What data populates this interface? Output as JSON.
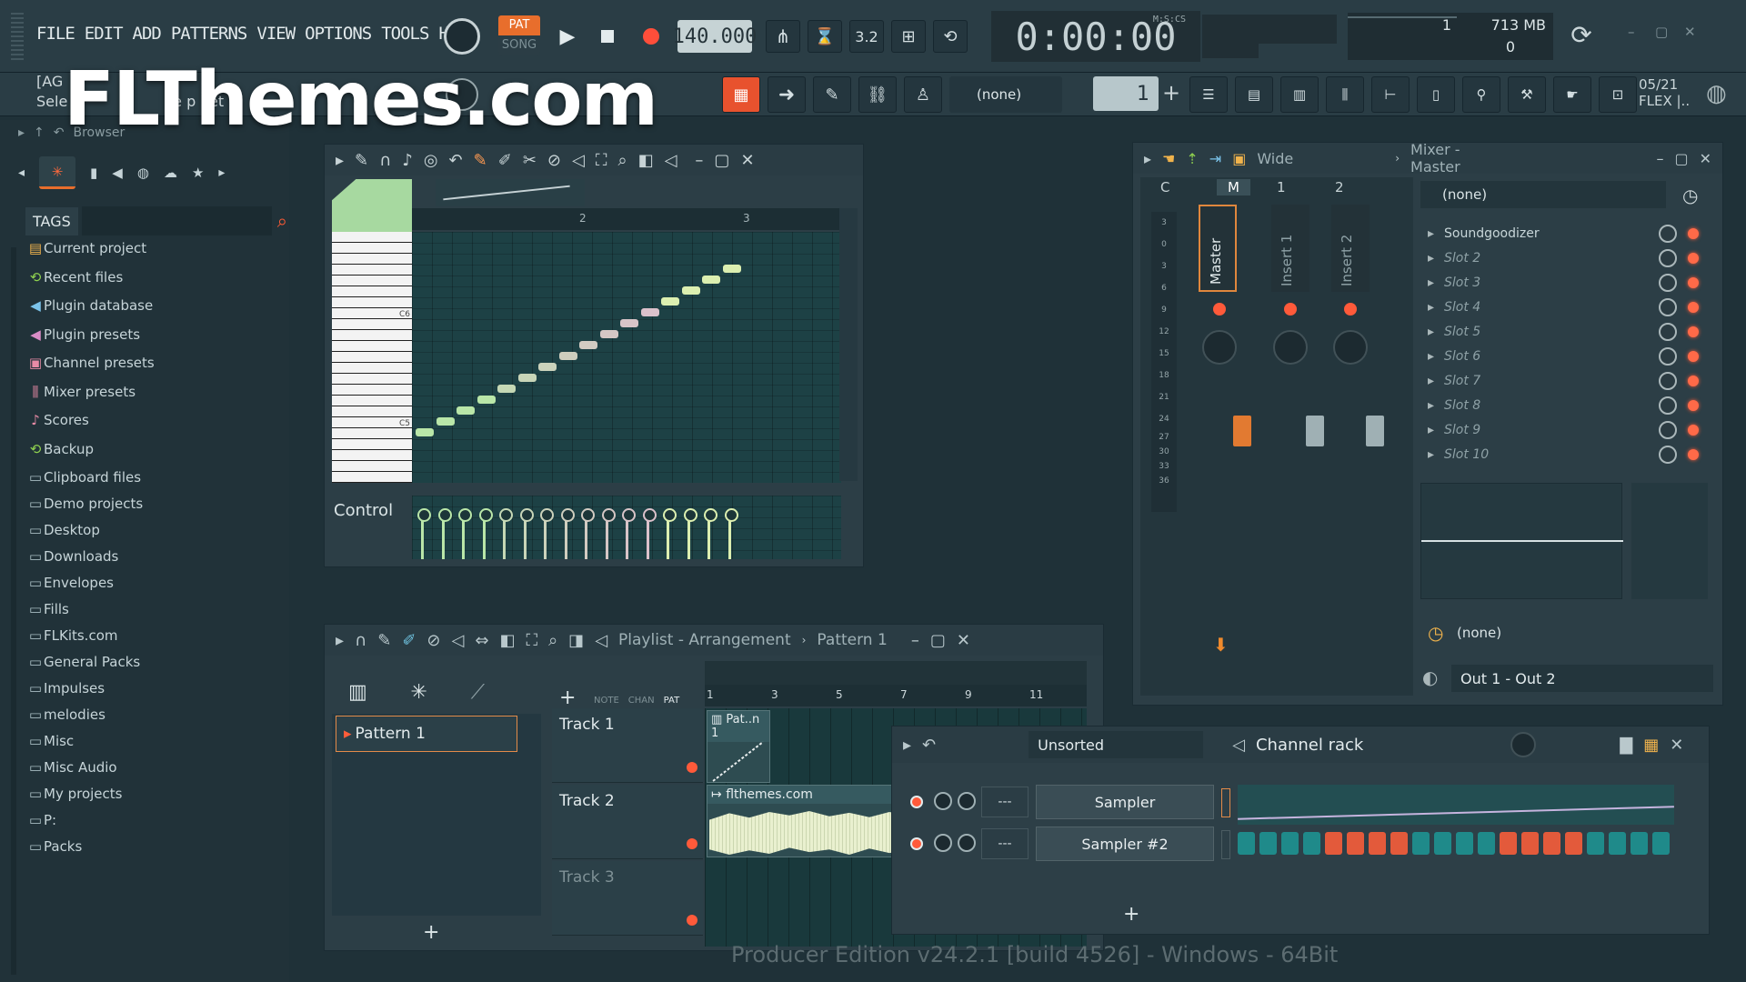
{
  "menu": [
    "FILE",
    "EDIT",
    "ADD",
    "PATTERNS",
    "VIEW",
    "OPTIONS",
    "TOOLS",
    "HELP"
  ],
  "transport": {
    "pat": "PAT",
    "song": "SONG",
    "tempo": "140.000",
    "time": "0:00:00",
    "time_unit": "M:S:CS",
    "metronome": "3.2"
  },
  "cpu": {
    "voices": "1",
    "memory": "713 MB",
    "polyphony": "0"
  },
  "hint": {
    "line1": "[AG",
    "line2": "Sele",
    "line2b": "he p",
    "line2c": "et"
  },
  "toolbar2": {
    "pattern_selector": "(none)",
    "pattern_number": "1",
    "news": "05/21",
    "news_line2": "FLEX |.."
  },
  "watermark": "FLThemes.com",
  "browser": {
    "title": "Browser",
    "tags_label": "TAGS",
    "items": [
      {
        "label": "Current project",
        "icon": "project-icon"
      },
      {
        "label": "Recent files",
        "icon": "folder-refresh-icon"
      },
      {
        "label": "Plugin database",
        "icon": "plugin-icon"
      },
      {
        "label": "Plugin presets",
        "icon": "plugin-preset-icon"
      },
      {
        "label": "Channel presets",
        "icon": "channel-icon"
      },
      {
        "label": "Mixer presets",
        "icon": "mixer-icon"
      },
      {
        "label": "Scores",
        "icon": "note-icon"
      },
      {
        "label": "Backup",
        "icon": "folder-refresh-icon"
      },
      {
        "label": "Clipboard files",
        "icon": "folder-icon"
      },
      {
        "label": "Demo projects",
        "icon": "folder-icon"
      },
      {
        "label": "Desktop",
        "icon": "folder-icon"
      },
      {
        "label": "Downloads",
        "icon": "folder-icon"
      },
      {
        "label": "Envelopes",
        "icon": "folder-icon"
      },
      {
        "label": "Fills",
        "icon": "folder-icon"
      },
      {
        "label": "FLKits.com",
        "icon": "folder-icon"
      },
      {
        "label": "General Packs",
        "icon": "folder-icon"
      },
      {
        "label": "Impulses",
        "icon": "folder-icon"
      },
      {
        "label": "melodies",
        "icon": "folder-icon"
      },
      {
        "label": "Misc",
        "icon": "folder-icon"
      },
      {
        "label": "Misc Audio",
        "icon": "folder-icon"
      },
      {
        "label": "My projects",
        "icon": "folder-icon"
      },
      {
        "label": "P:",
        "icon": "folder-icon"
      },
      {
        "label": "Packs",
        "icon": "folder-icon"
      }
    ]
  },
  "piano_roll": {
    "ruler": [
      "2",
      "3"
    ],
    "key_labels": [
      "C6",
      "C5"
    ],
    "control_label": "Control"
  },
  "playlist": {
    "title": "Playlist - Arrangement",
    "pattern": "Pattern 1",
    "picker_item": "Pattern 1",
    "add": "+",
    "tabs": [
      "NOTE",
      "CHAN",
      "PAT"
    ],
    "ruler": [
      "1",
      "3",
      "5",
      "7",
      "9",
      "11"
    ],
    "tracks": [
      "Track 1",
      "Track 2",
      "Track 3"
    ],
    "clip1": "Pat..n 1",
    "clip2": "flthemes.com"
  },
  "mixer": {
    "title": "Mixer - Master",
    "view": "Wide",
    "headers": [
      "C",
      "M",
      "1",
      "2"
    ],
    "tracks": [
      "Master",
      "Insert 1",
      "Insert 2"
    ],
    "scale": [
      "3",
      "0",
      "3",
      "6",
      "9",
      "12",
      "15",
      "18",
      "21",
      "24",
      "27",
      "30",
      "33",
      "36"
    ],
    "preset": "(none)",
    "slots": [
      "Soundgoodizer",
      "Slot 2",
      "Slot 3",
      "Slot 4",
      "Slot 5",
      "Slot 6",
      "Slot 7",
      "Slot 8",
      "Slot 9",
      "Slot 10"
    ],
    "post_preset": "(none)",
    "output": "Out 1 - Out 2"
  },
  "channel_rack": {
    "title": "Channel rack",
    "filter": "Unsorted",
    "channels": [
      {
        "name": "Sampler",
        "target": "---"
      },
      {
        "name": "Sampler #2",
        "target": "---"
      }
    ],
    "add": "+"
  },
  "footer": {
    "version": "Producer Edition v24.2.1 [build 4526] - Windows - 64Bit"
  },
  "colors": {
    "accent": "#e86e2c",
    "led": "#ff6a48",
    "note_green": "#b9e6a8",
    "note_pink": "#e7b3d8",
    "step_orange": "#e35a3b",
    "step_teal": "#1f8a8a"
  }
}
